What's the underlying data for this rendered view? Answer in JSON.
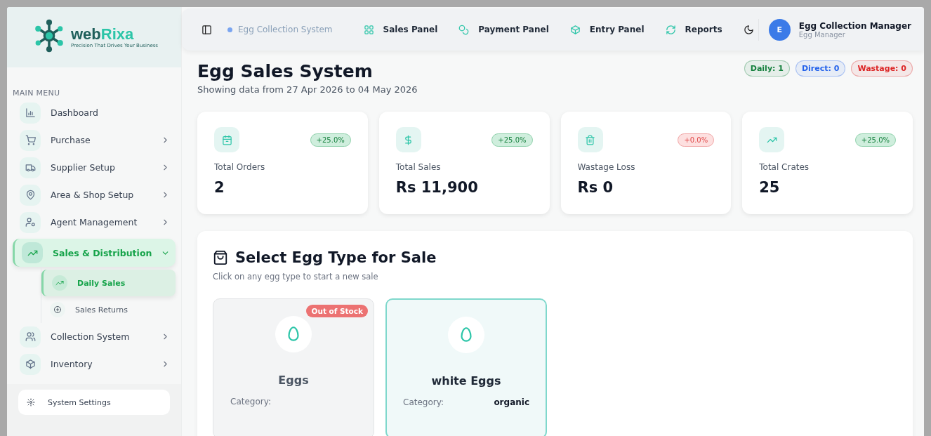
{
  "brand": {
    "name_start": "web",
    "name_end": "Rixa",
    "tagline": "Precision That Drives Your Business"
  },
  "header": {
    "system": "Egg Collection System",
    "nav": [
      {
        "label": "Sales Panel"
      },
      {
        "label": "Payment Panel"
      },
      {
        "label": "Entry Panel"
      },
      {
        "label": "Reports"
      }
    ],
    "user": {
      "initial": "E",
      "name": "Egg Collection Manager",
      "role": "Egg Manager"
    }
  },
  "sidebar": {
    "section": "MAIN MENU",
    "items": [
      {
        "label": "Dashboard",
        "selected": false,
        "expandable": false
      },
      {
        "label": "Purchase",
        "selected": false,
        "expandable": true,
        "expanded": false
      },
      {
        "label": "Supplier Setup",
        "selected": false,
        "expandable": true,
        "expanded": false
      },
      {
        "label": "Area & Shop Setup",
        "selected": false,
        "expandable": true,
        "expanded": false
      },
      {
        "label": "Agent Management",
        "selected": false,
        "expandable": true,
        "expanded": false
      },
      {
        "label": "Sales & Distribution",
        "selected": true,
        "expandable": true,
        "expanded": true,
        "children": [
          {
            "label": "Daily Sales",
            "selected": true
          },
          {
            "label": "Sales Returns",
            "selected": false
          }
        ]
      },
      {
        "label": "Collection System",
        "selected": false,
        "expandable": true,
        "expanded": false
      },
      {
        "label": "Inventory",
        "selected": false,
        "expandable": true,
        "expanded": false
      }
    ],
    "footer": "System Settings"
  },
  "page": {
    "title": "Egg Sales System",
    "subtitle": "Showing data from 27 Apr 2026 to 04 May 2026",
    "counters": [
      {
        "label": "Daily: 1",
        "color": "#15803d"
      },
      {
        "label": "Direct: 0",
        "color": "#2563eb"
      },
      {
        "label": "Wastage: 0",
        "color": "#dc2626"
      }
    ],
    "stats": [
      {
        "label": "Total Orders",
        "value": "2",
        "change": "+25.0%",
        "kind": "positive"
      },
      {
        "label": "Total Sales",
        "value": "Rs 11,900",
        "change": "+25.0%",
        "kind": "positive"
      },
      {
        "label": "Wastage Loss",
        "value": "Rs 0",
        "change": "+0.0%",
        "kind": "negative"
      },
      {
        "label": "Total Crates",
        "value": "25",
        "change": "+25.0%",
        "kind": "positive"
      }
    ]
  },
  "egg_section": {
    "title": "Select Egg Type for Sale",
    "subtitle": "Click on any egg type to start a new sale",
    "cards": [
      {
        "name": "Eggs",
        "badge": "Out of Stock",
        "out_of_stock": true,
        "selected": false,
        "category_label": "Category:"
      },
      {
        "name": "white Eggs",
        "out_of_stock": false,
        "selected": true,
        "category_label": "Category:",
        "category": "organic"
      }
    ]
  }
}
